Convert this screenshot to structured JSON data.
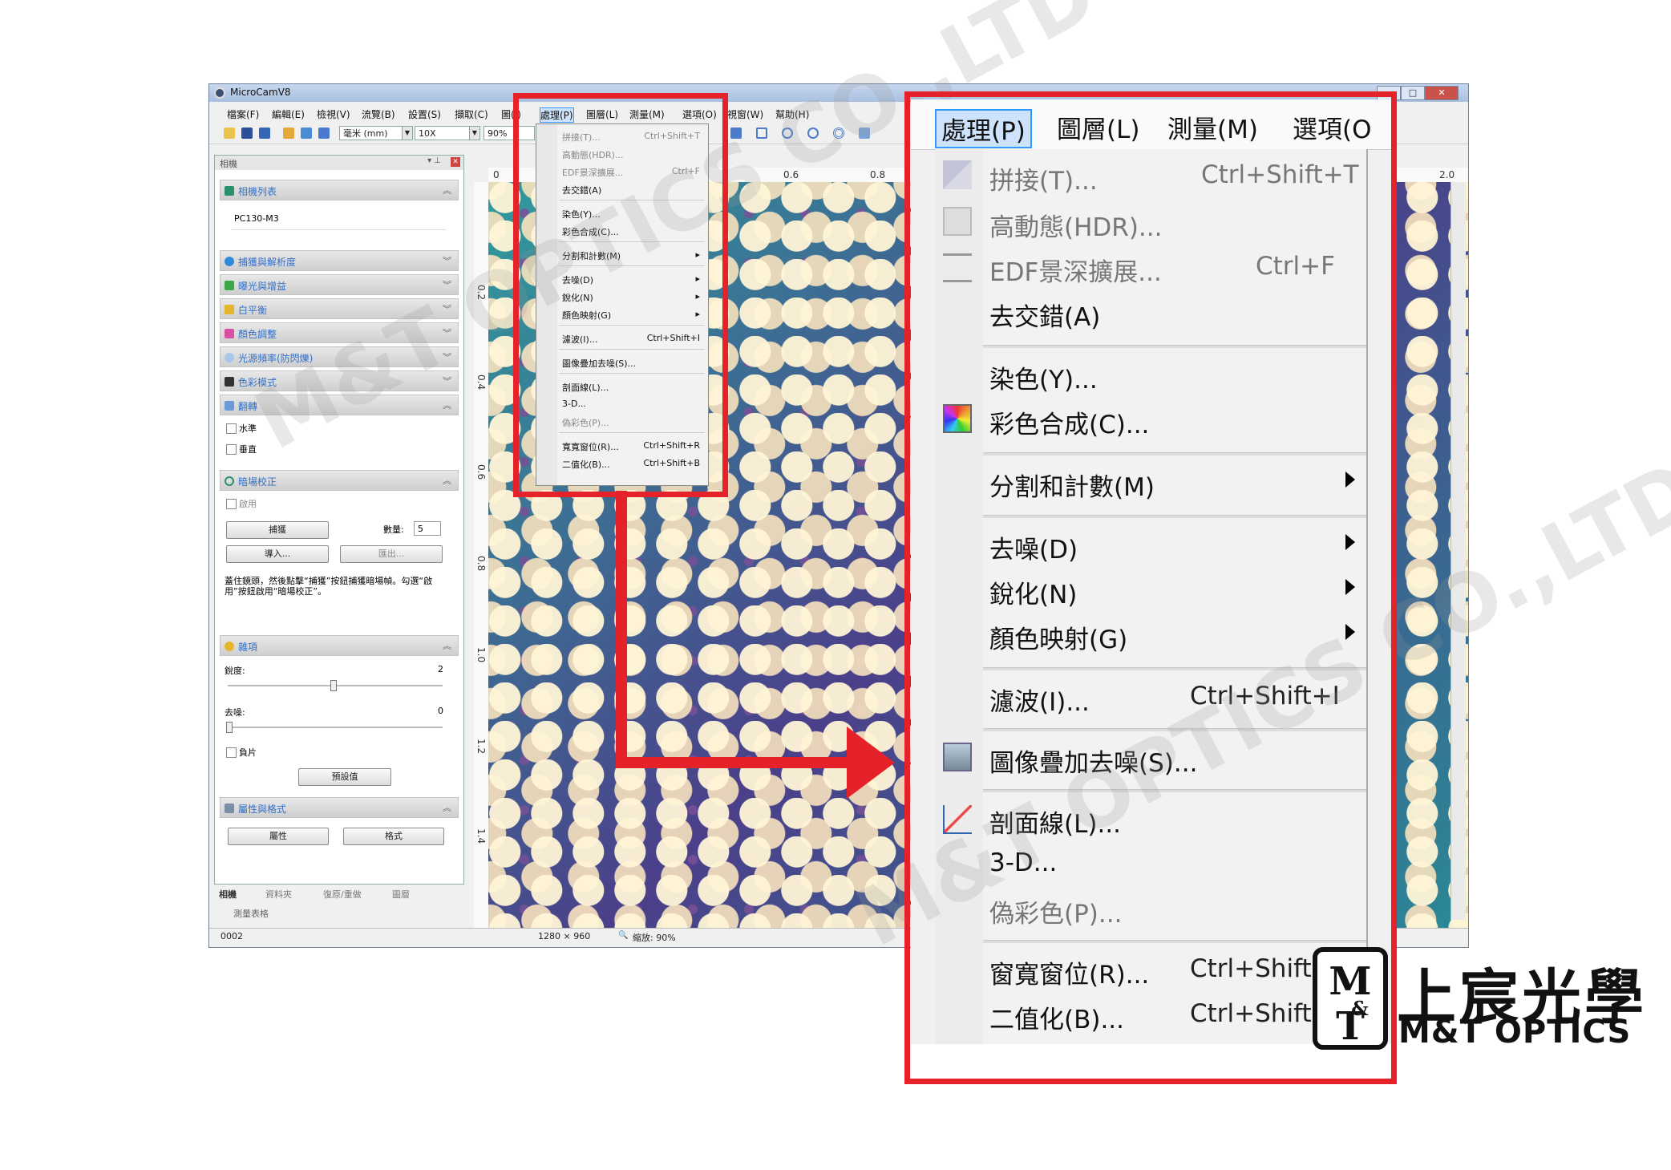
{
  "app": {
    "title": "MicroCamV8",
    "menu": [
      "檔案(F)",
      "編輯(E)",
      "檢視(V)",
      "流覽(B)",
      "設置(S)",
      "擷取(C)",
      "圖(I)",
      "處理(P)",
      "圖層(L)",
      "測量(M)",
      "選項(O)",
      "視窗(W)",
      "幫助(H)"
    ],
    "toolbar": {
      "unit": "毫米 (mm)",
      "magnification": "10X",
      "zoom": "90%"
    }
  },
  "panel": {
    "header": "相機",
    "camera_list_title": "相機列表",
    "camera_name": "PC130-M3",
    "sections": [
      "捕獲與解析度",
      "曝光與增益",
      "白平衡",
      "顏色調整",
      "光源頻率(防閃爍)",
      "色彩模式"
    ],
    "flip_title": "翻轉",
    "flip_horizontal": "水準",
    "flip_vertical": "垂直",
    "dark_title": "暗場校正",
    "dark_enable": "啟用",
    "dark_capture": "捕獲",
    "dark_count_label": "數量:",
    "dark_count_value": "5",
    "dark_import": "導入...",
    "dark_export": "匯出...",
    "dark_note": "蓋住鏡頭，然後點擊“捕獲”按鈕捕獲暗場幀。勾選“啟用”按鈕啟用“暗場校正”。",
    "misc_title": "雜項",
    "sharpness_label": "銳度:",
    "sharpness_value": "2",
    "denoise_label": "去噪:",
    "denoise_value": "0",
    "negative_label": "負片",
    "default_button": "預設值",
    "props_title": "屬性與格式",
    "props_button": "屬性",
    "format_button": "格式",
    "tabs": [
      "相機",
      "資料夾",
      "復原/重做",
      "圖層"
    ],
    "measure_tab": "測量表格"
  },
  "status": {
    "frame": "0002",
    "resolution": "1280 × 960",
    "zoom": "縮放: 90%"
  },
  "ruler": {
    "top": [
      "0",
      "0.6",
      "0.8",
      "2.0"
    ],
    "left": [
      "0.2",
      "0.4",
      "0.6",
      "0.8",
      "1.0",
      "1.2",
      "1.4"
    ]
  },
  "small_menu": {
    "items": [
      {
        "label": "拼接(T)...",
        "shortcut": "Ctrl+Shift+T"
      },
      {
        "label": "高動態(HDR)...",
        "shortcut": ""
      },
      {
        "label": "EDF景深擴展...",
        "shortcut": "Ctrl+F"
      },
      {
        "label": "去交錯(A)",
        "shortcut": ""
      },
      {
        "label": "染色(Y)...",
        "shortcut": ""
      },
      {
        "label": "彩色合成(C)...",
        "shortcut": ""
      },
      {
        "label": "分割和計數(M)",
        "shortcut": ""
      },
      {
        "label": "去噪(D)",
        "shortcut": ""
      },
      {
        "label": "銳化(N)",
        "shortcut": ""
      },
      {
        "label": "顏色映射(G)",
        "shortcut": ""
      },
      {
        "label": "濾波(I)...",
        "shortcut": "Ctrl+Shift+I"
      },
      {
        "label": "圖像疊加去噪(S)...",
        "shortcut": ""
      },
      {
        "label": "剖面線(L)...",
        "shortcut": ""
      },
      {
        "label": "3-D...",
        "shortcut": ""
      },
      {
        "label": "偽彩色(P)...",
        "shortcut": ""
      },
      {
        "label": "寬寬窗位(R)...",
        "shortcut": "Ctrl+Shift+R"
      },
      {
        "label": "二值化(B)...",
        "shortcut": "Ctrl+Shift+B"
      }
    ]
  },
  "zoom_menu": {
    "menubar": [
      "處理(P)",
      "圖層(L)",
      "測量(M)",
      "選項(O"
    ],
    "items": {
      "stitch": {
        "label": "拼接(T)...",
        "shortcut": "Ctrl+Shift+T"
      },
      "hdr": {
        "label": "高動態(HDR)..."
      },
      "edf": {
        "label": "EDF景深擴展...",
        "shortcut": "Ctrl+F"
      },
      "deinterlace": {
        "label": "去交錯(A)"
      },
      "stain": {
        "label": "染色(Y)..."
      },
      "composite": {
        "label": "彩色合成(C)..."
      },
      "segment": {
        "label": "分割和計數(M)"
      },
      "denoise": {
        "label": "去噪(D)"
      },
      "sharpen": {
        "label": "銳化(N)"
      },
      "colormap": {
        "label": "顏色映射(G)"
      },
      "filter": {
        "label": "濾波(I)...",
        "shortcut": "Ctrl+Shift+I"
      },
      "stack": {
        "label": "圖像疊加去噪(S)..."
      },
      "profile": {
        "label": "剖面線(L)..."
      },
      "threed": {
        "label": "3-D..."
      },
      "pseudo": {
        "label": "偽彩色(P)..."
      },
      "window": {
        "label": "窗寬窗位(R)...",
        "shortcut": "Ctrl+Shift"
      },
      "binarize": {
        "label": "二值化(B)...",
        "shortcut": "Ctrl+Shift+"
      }
    }
  },
  "watermark": "M&T OPTICS CO.,LTD",
  "brand": {
    "chinese": "上宸光學",
    "english": "M&T OPTICS",
    "logo": "M&T"
  },
  "colors": {
    "highlight_red": "#e52229",
    "menu_bg": "#f2f2f2"
  }
}
